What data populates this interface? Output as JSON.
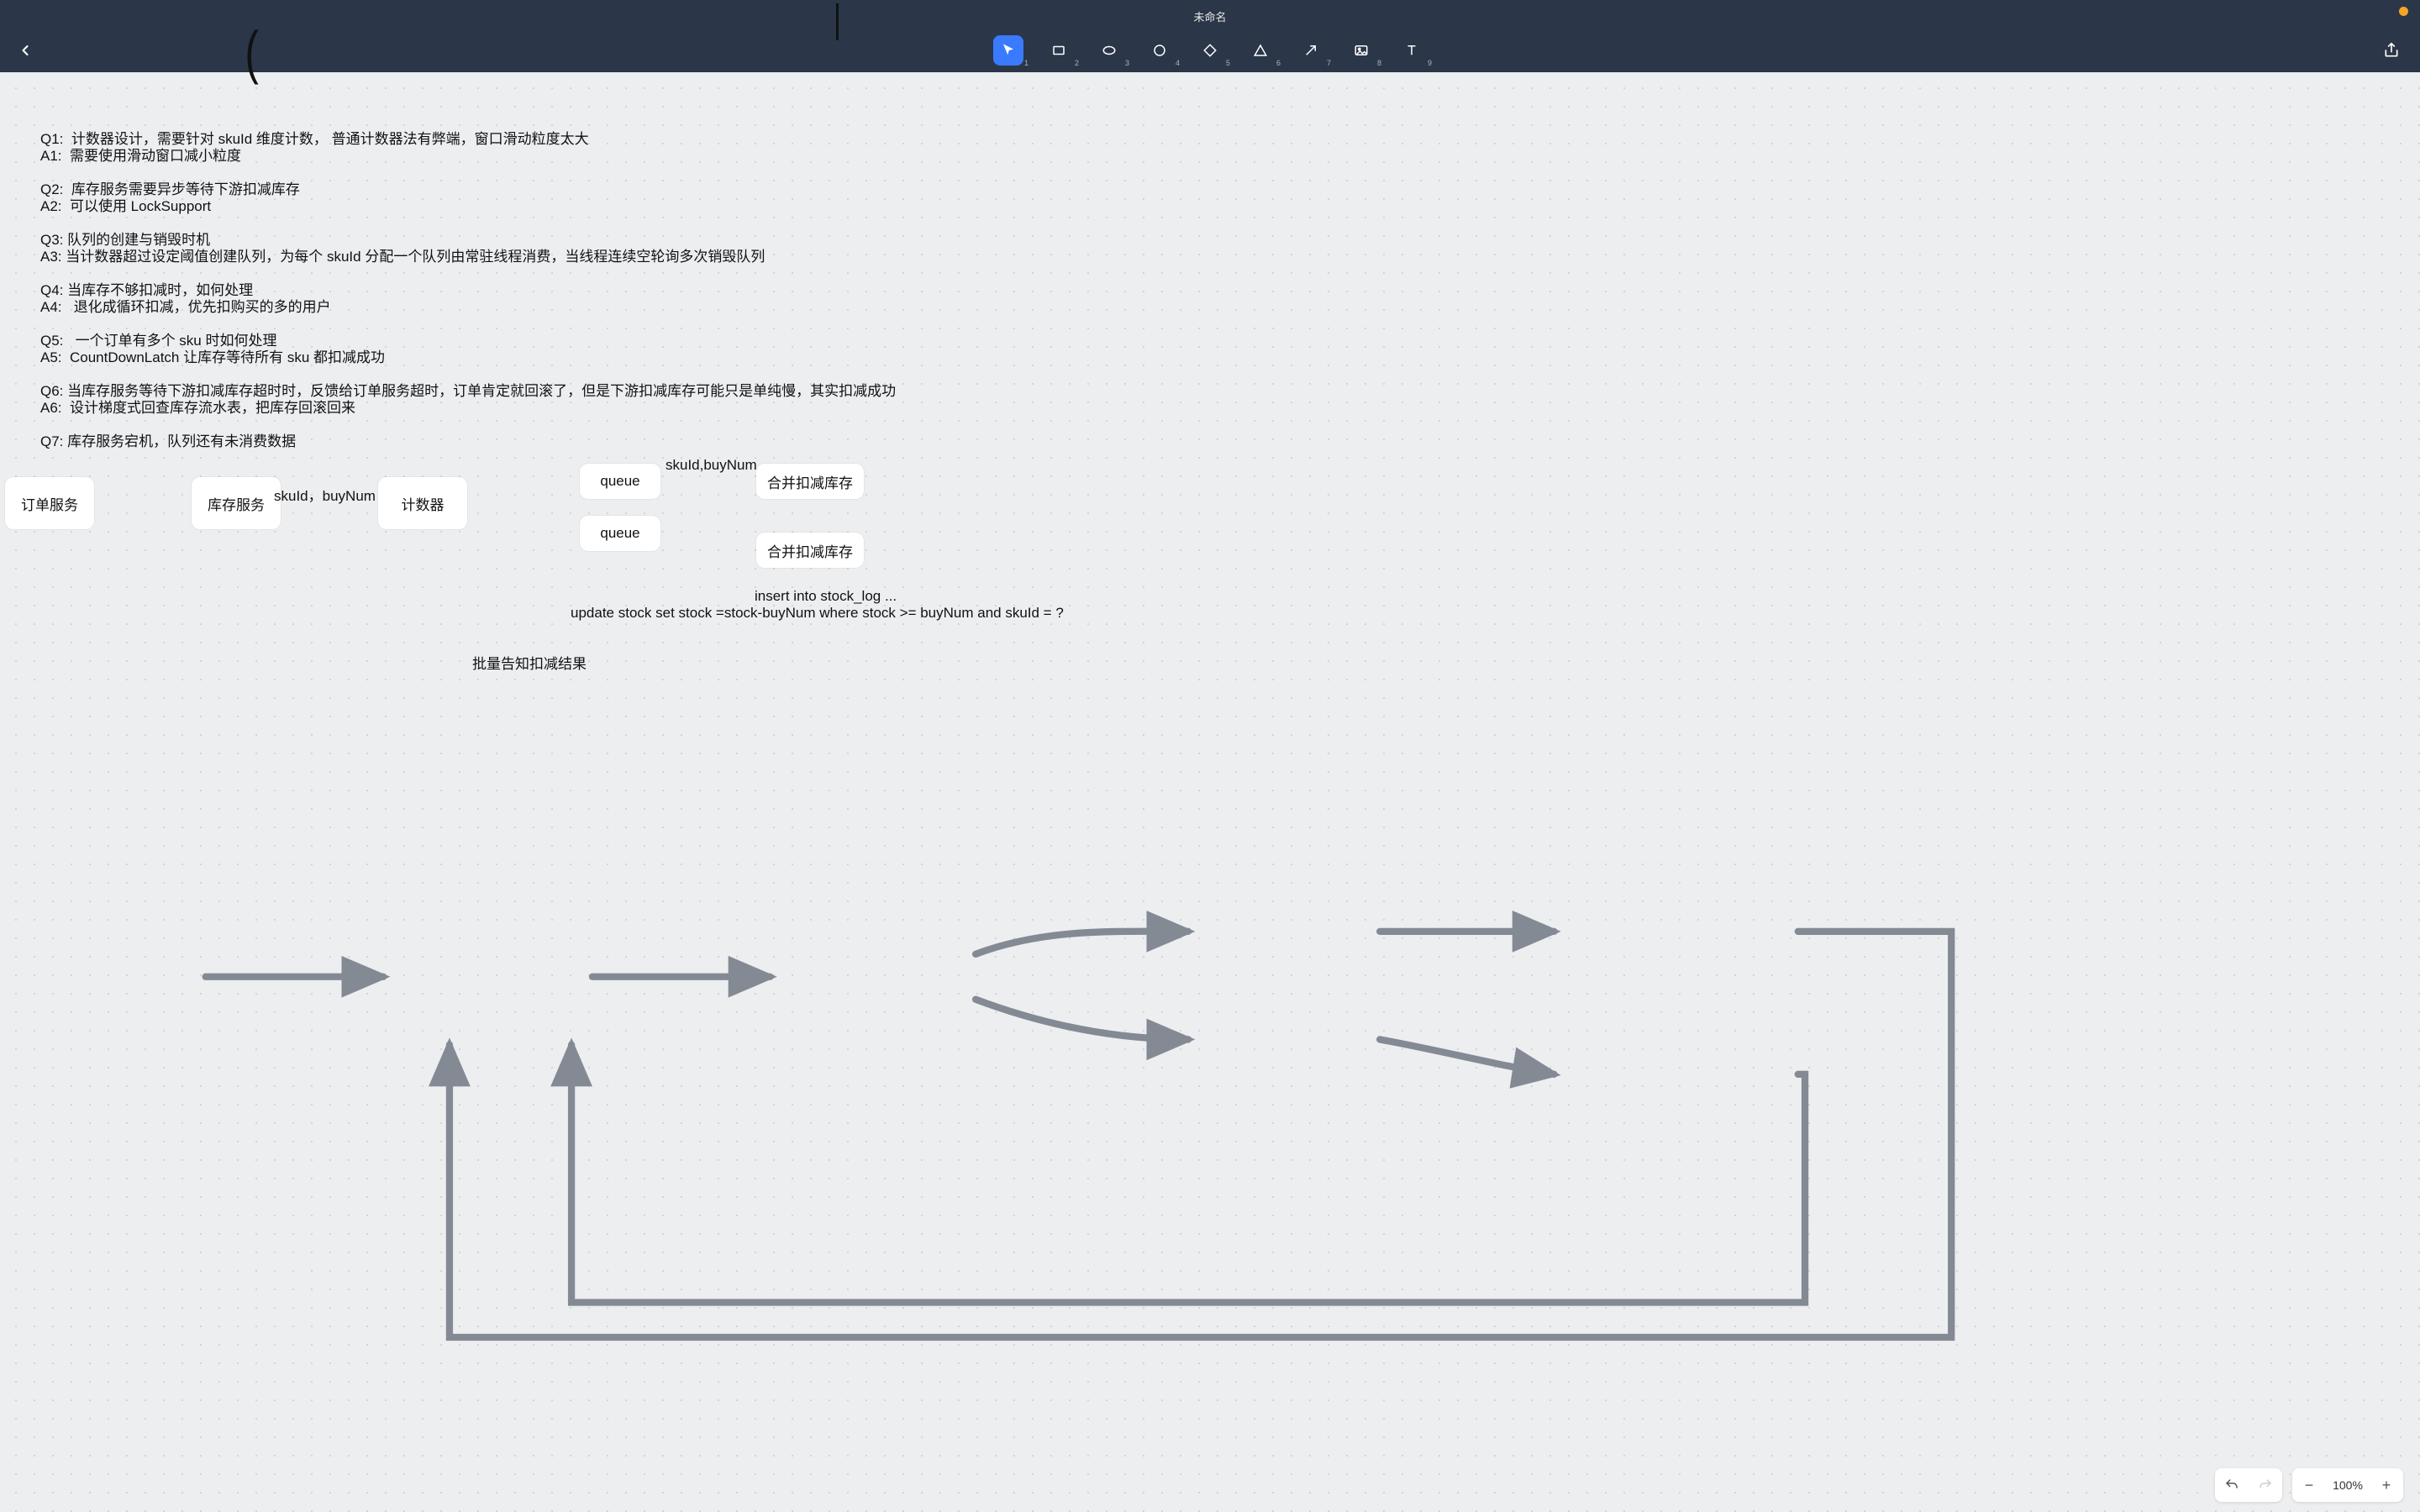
{
  "header": {
    "title": "未命名",
    "tools": [
      {
        "name": "select",
        "sub": "1"
      },
      {
        "name": "rectangle",
        "sub": "2"
      },
      {
        "name": "ellipse",
        "sub": "3"
      },
      {
        "name": "circle",
        "sub": "4"
      },
      {
        "name": "diamond",
        "sub": "5"
      },
      {
        "name": "triangle",
        "sub": "6"
      },
      {
        "name": "arrow",
        "sub": "7"
      },
      {
        "name": "image",
        "sub": "8"
      },
      {
        "name": "text",
        "sub": "9"
      }
    ]
  },
  "qa": {
    "lines": [
      "Q1:  计数器设计，需要针对 skuId 维度计数， 普通计数器法有弊端，窗口滑动粒度太大",
      "A1:  需要使用滑动窗口减小粒度",
      "",
      "Q2:  库存服务需要异步等待下游扣减库存",
      "A2:  可以使用 LockSupport",
      "",
      "Q3: 队列的创建与销毁时机",
      "A3: 当计数器超过设定阈值创建队列，为每个 skuId 分配一个队列由常驻线程消费，当线程连续空轮询多次销毁队列",
      "",
      "Q4: 当库存不够扣减时，如何处理",
      "A4:   退化成循环扣减，优先扣购买的多的用户",
      "",
      "Q5:   一个订单有多个 sku 时如何处理",
      "A5:  CountDownLatch 让库存等待所有 sku 都扣减成功",
      "",
      "Q6: 当库存服务等待下游扣减库存超时时，反馈给订单服务超时，订单肯定就回滚了，但是下游扣减库存可能只是单纯慢，其实扣减成功",
      "A6:  设计梯度式回查库存流水表，把库存回滚回来",
      "",
      "Q7: 库存服务宕机，队列还有未消费数据"
    ]
  },
  "nodes": {
    "order_service": "订单服务",
    "stock_service": "库存服务",
    "counter": "计数器",
    "queue": "queue",
    "merge_deduct": "合并扣减库存"
  },
  "labels": {
    "sku_buynum_1": "skuId，buyNum",
    "sku_buynum_2": "skuId,buyNum",
    "batch_result": "批量告知扣减结果",
    "sql1": "insert into stock_log ...",
    "sql2": "update stock set stock =stock-buyNum where stock >= buyNum and skuId = ?"
  },
  "footer": {
    "zoom": "100%"
  },
  "colors": {
    "header_bg": "#2b3648",
    "accent": "#3a7afe",
    "arrow": "#848a94"
  }
}
